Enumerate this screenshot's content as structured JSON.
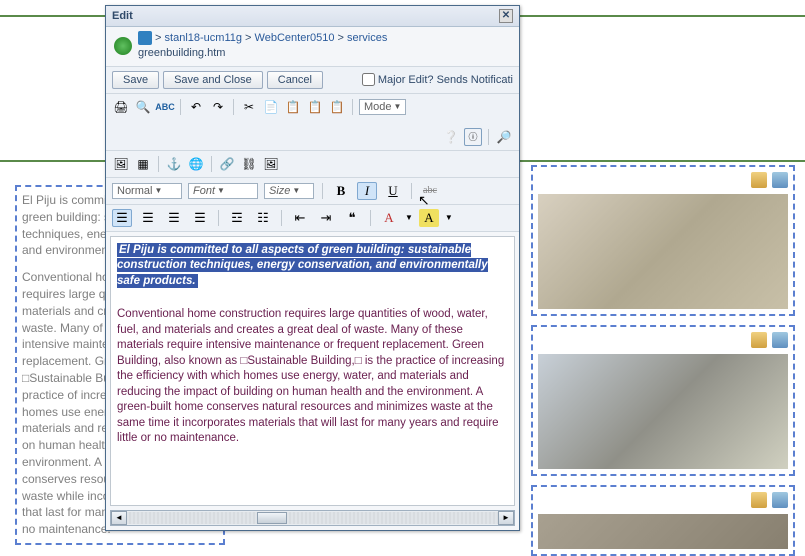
{
  "dialog": {
    "title": "Edit",
    "breadcrumb": {
      "seg1": "stanl18-ucm11g",
      "seg2": "WebCenter0510",
      "seg3": "services",
      "file": "greenbuilding.htm"
    },
    "buttons": {
      "save": "Save",
      "saveClose": "Save and Close",
      "cancel": "Cancel"
    },
    "majorEdit": "Major Edit? Sends Notificati"
  },
  "toolbar": {
    "mode": "Mode",
    "normal": "Normal",
    "font": "Font",
    "size": "Size"
  },
  "editor": {
    "selected": "El Piju is committed to all aspects of green building: sustainable construction techniques, energy conservation, and environmentally safe products.",
    "body": "Conventional home construction requires large quantities of wood, water, fuel, and materials and creates a great deal of waste. Many of these materials require intensive maintenance or frequent replacement. Green Building, also known as □Sustainable Building,□ is the practice of increasing the efficiency with which homes use energy, water, and materials and reducing the impact of building on human health and the environment. A green-built home conserves natural resources and minimizes waste at the same time it incorporates materials that will last for many years and require little or no maintenance."
  },
  "bgtext": {
    "p1": "El Piju is committed to all aspects of green building: sustainable techniques, energy conservation, and environmentally safe products.",
    "p2": "Conventional home construction requires large quantities of wood, materials and creates a great deal of waste. Many of these require intensive maintenance or frequent replacement. Green Building, □Sustainable Building,□ is the practice of increasing the efficiency homes use energy, water, and materials and reducing the impact on human health and the environment. A green-built home conserves resources and minimizes waste while incorporating materials that last for many years with little or no maintenance."
  }
}
